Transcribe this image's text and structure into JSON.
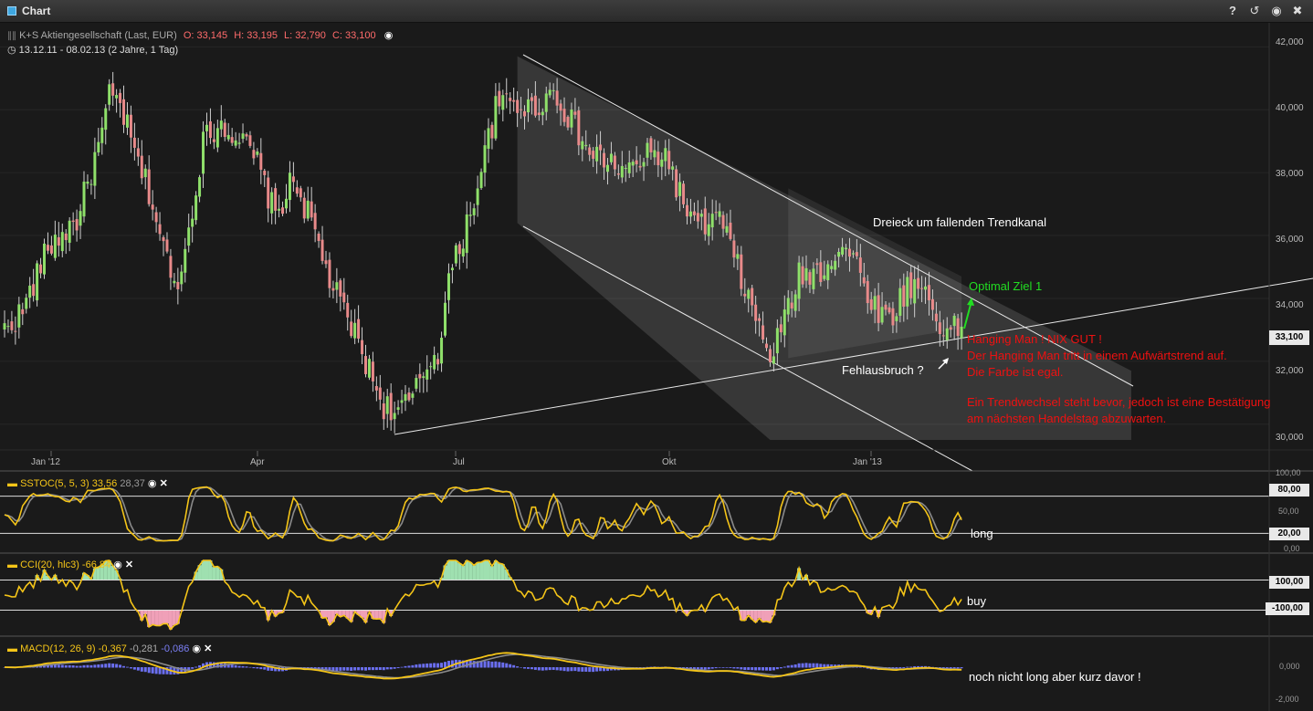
{
  "window": {
    "title": "Chart",
    "help_label": "?"
  },
  "instrument": {
    "name": "K+S Aktiengesellschaft (Last, EUR)",
    "open": "O: 33,145",
    "high": "H: 33,195",
    "low": "L: 32,790",
    "close": "C: 33,100",
    "range": "13.12.11 - 08.02.13 (2 Jahre, 1 Tag)"
  },
  "price_axis": {
    "ticks": [
      "42,000",
      "40,000",
      "38,000",
      "36,000",
      "34,000",
      "32,000",
      "30,000"
    ],
    "last_price": "33,100"
  },
  "time_axis": {
    "ticks": [
      "Jan '12",
      "Apr",
      "Jul",
      "Okt",
      "Jan '13"
    ]
  },
  "chart_data": {
    "type": "candlestick",
    "y_range": [
      29.5,
      42.3
    ],
    "close_anchors": [
      [
        0,
        33.0
      ],
      [
        5,
        33.6
      ],
      [
        12,
        35.6
      ],
      [
        20,
        36.5
      ],
      [
        27,
        39.2
      ],
      [
        29,
        40.4
      ],
      [
        32,
        40.2
      ],
      [
        36,
        38.6
      ],
      [
        40,
        37.4
      ],
      [
        45,
        35.2
      ],
      [
        47,
        34.3
      ],
      [
        50,
        35.5
      ],
      [
        55,
        39.0
      ],
      [
        60,
        39.6
      ],
      [
        65,
        39.1
      ],
      [
        70,
        38.3
      ],
      [
        75,
        36.6
      ],
      [
        80,
        37.8
      ],
      [
        85,
        36.4
      ],
      [
        90,
        34.6
      ],
      [
        93,
        33.8
      ],
      [
        98,
        32.6
      ],
      [
        102,
        31.4
      ],
      [
        105,
        30.6
      ],
      [
        109,
        30.4
      ],
      [
        113,
        30.8
      ],
      [
        117,
        31.9
      ],
      [
        120,
        32.3
      ],
      [
        123,
        34.6
      ],
      [
        126,
        35.6
      ],
      [
        130,
        37.2
      ],
      [
        133,
        38.6
      ],
      [
        136,
        40.0
      ],
      [
        140,
        40.3
      ],
      [
        146,
        40.0
      ],
      [
        152,
        40.6
      ],
      [
        156,
        39.8
      ],
      [
        162,
        38.6
      ],
      [
        168,
        38.3
      ],
      [
        172,
        38.0
      ],
      [
        178,
        38.5
      ],
      [
        183,
        38.6
      ],
      [
        188,
        37.0
      ],
      [
        192,
        36.2
      ],
      [
        198,
        36.6
      ],
      [
        202,
        35.3
      ],
      [
        206,
        34.0
      ],
      [
        209,
        33.0
      ],
      [
        212,
        32.1
      ],
      [
        215,
        33.0
      ],
      [
        220,
        34.7
      ],
      [
        226,
        34.9
      ],
      [
        232,
        35.7
      ],
      [
        236,
        35.1
      ],
      [
        240,
        33.9
      ],
      [
        245,
        33.3
      ],
      [
        250,
        34.4
      ],
      [
        255,
        34.3
      ],
      [
        258,
        33.4
      ],
      [
        261,
        32.9
      ],
      [
        265,
        33.1
      ]
    ],
    "annotations": {
      "channel_label": "Dreieck um fallenden Trendkanal",
      "target_label": "Optimal Ziel 1",
      "false_break_label": "Fehlausbruch ?",
      "hanging_man_title": "Hanging Man ! NIX GUT !",
      "hanging_man_line1": "Der Hanging Man tritt in einem Aufwärtstrend auf.",
      "hanging_man_line2": "Die Farbe ist egal.",
      "trend_line1": "Ein Trendwechsel steht bevor, jedoch ist eine Bestätigung",
      "trend_line2": "am nächsten Handelstag abzuwarten."
    }
  },
  "indicators": {
    "sstoc": {
      "label": "SSTOC(5, 5, 3)",
      "value1": "33,56",
      "value2": "28,37",
      "axis_labels": [
        "100,00",
        "50,00",
        "0,00"
      ],
      "level_upper": "80,00",
      "level_lower": "20,00",
      "comment": "long"
    },
    "cci": {
      "label": "CCI(20, hlc3)",
      "value1": "-66,84",
      "level_upper": "100,00",
      "level_lower": "-100,00",
      "comment": "buy"
    },
    "macd": {
      "label": "MACD(12, 26, 9)",
      "value1": "-0,367",
      "value2": "-0,281",
      "value3": "-0,086",
      "axis_labels": [
        "0,000",
        "-2,000"
      ],
      "comment": "noch nicht long aber kurz davor !"
    }
  },
  "colors": {
    "up": "#8fe06a",
    "down": "#e88a8a",
    "background": "#1a1a1a",
    "indicator_line": "#f5c518",
    "alert_text": "#ee1111",
    "target_text": "#22dd22",
    "macd_hist": "#6b6ff0"
  }
}
